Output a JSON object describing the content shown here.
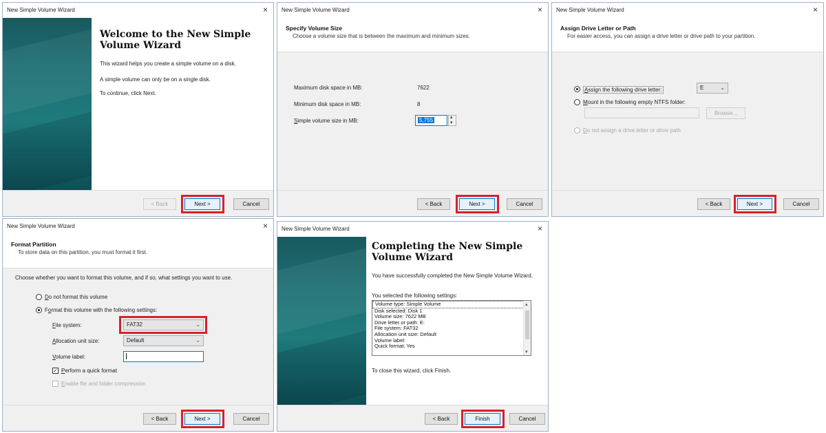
{
  "common": {
    "window_title": "New Simple Volume Wizard",
    "close_glyph": "×",
    "back_label": "< Back",
    "next_label": "Next >",
    "cancel_label": "Cancel",
    "finish_label": "Finish",
    "accent_highlight": "#d9202c"
  },
  "welcome": {
    "heading": "Welcome to the New Simple Volume Wizard",
    "line1": "This wizard helps you create a simple volume on a disk.",
    "line2": "A simple volume can only be on a single disk.",
    "line3": "To continue, click Next."
  },
  "size": {
    "title": "Specify Volume Size",
    "subtitle": "Choose a volume size that is between the maximum and minimum sizes.",
    "max_label": "Maximum disk space in MB:",
    "max_value": "7622",
    "min_label": "Minimum disk space in MB:",
    "min_value": "8",
    "simple_label": "Simple volume size in MB:",
    "simple_value": "5,755"
  },
  "letter": {
    "title": "Assign Drive Letter or Path",
    "subtitle": "For easier access, you can assign a drive letter or drive path to your partition.",
    "opt_assign": "Assign the following drive letter:",
    "drive_letter": "E",
    "opt_mount": "Mount in the following empty NTFS folder:",
    "browse_label": "Browse...",
    "opt_none": "Do not assign a drive letter or drive path"
  },
  "format": {
    "title": "Format Partition",
    "subtitle": "To store data on this partition, you must format it first.",
    "question": "Choose whether you want to format this volume, and if so, what settings you want to use.",
    "opt_no": "Do not format this volume",
    "opt_yes": "Format this volume with the following settings:",
    "fs_label": "File system:",
    "fs_value": "FAT32",
    "alloc_label": "Allocation unit size:",
    "alloc_value": "Default",
    "vol_label": "Volume label:",
    "vol_value": "",
    "quick_label": "Perform a quick format",
    "compress_label": "Enable file and folder compression"
  },
  "complete": {
    "heading": "Completing the New Simple Volume Wizard",
    "success": "You have successfully completed the New Simple Volume Wizard.",
    "selected": "You selected the following settings:",
    "settings": [
      "Volume type: Simple Volume",
      "Disk selected: Disk 1",
      "Volume size: 7622 MB",
      "Drive letter or path: E:",
      "File system: FAT32",
      "Allocation unit size: Default",
      "Volume label:",
      "Quick format: Yes"
    ],
    "close_text": "To close this wizard, click Finish."
  }
}
